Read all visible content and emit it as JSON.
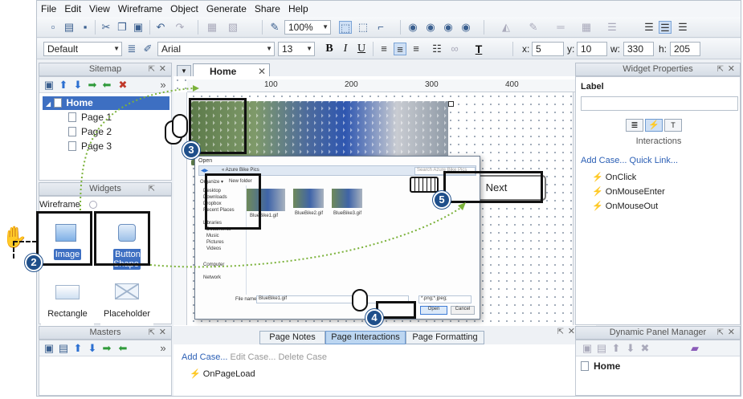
{
  "menu": [
    "File",
    "Edit",
    "View",
    "Wireframe",
    "Object",
    "Generate",
    "Share",
    "Help"
  ],
  "toolbar": {
    "zoom": "100%"
  },
  "format_bar": {
    "style": "Default",
    "font": "Arial",
    "size": "13",
    "x_label": "x:",
    "x": "5",
    "y_label": "y:",
    "y": "10",
    "w_label": "w:",
    "w": "330",
    "h_label": "h:",
    "h": "205"
  },
  "sitemap": {
    "title": "Sitemap",
    "root": "Home",
    "pages": [
      "Page 1",
      "Page 2",
      "Page 3"
    ]
  },
  "widgets": {
    "title": "Widgets",
    "library": "Wireframe",
    "items": [
      "Image",
      "Button Shape",
      "Rectangle",
      "Placeholder"
    ]
  },
  "masters": {
    "title": "Masters"
  },
  "canvas": {
    "tab": "Home",
    "ruler": [
      "100",
      "200",
      "300",
      "400"
    ],
    "button_text": "Next"
  },
  "open_dialog": {
    "title": "Open",
    "path": "« Azure Bike Pics",
    "search_placeholder": "Search Azure Bike Pics",
    "organize": "Organize ▾",
    "new_folder": "New folder",
    "nav": [
      "Desktop",
      "Downloads",
      "Dropbox",
      "Recent Places",
      "Libraries",
      "Documents",
      "Music",
      "Pictures",
      "Videos",
      "Computer",
      "Network"
    ],
    "files": [
      "BlueBike1.gif",
      "BlueBike2.gif",
      "BlueBike3.gif"
    ],
    "filename_label": "File name:",
    "filename": "BlueBike1.gif",
    "filetype": "*.png;*.jpeg;",
    "open": "Open",
    "cancel": "Cancel"
  },
  "page_panel": {
    "tabs": [
      "Page Notes",
      "Page Interactions",
      "Page Formatting"
    ],
    "add_case": "Add Case...",
    "edit_case": "Edit Case...",
    "delete_case": "Delete Case",
    "event": "OnPageLoad"
  },
  "widget_properties": {
    "title": "Widget Properties",
    "label": "Label",
    "interactions": "Interactions",
    "add_case": "Add Case...",
    "quick_link": "Quick Link...",
    "events": [
      "OnClick",
      "OnMouseEnter",
      "OnMouseOut"
    ]
  },
  "dynamic_panel_manager": {
    "title": "Dynamic Panel Manager",
    "item": "Home"
  },
  "steps": [
    "2",
    "3",
    "4",
    "5"
  ],
  "colors": {
    "accent": "#3d6fc2",
    "badge": "#1f4f8a",
    "callout_green": "#9ecf5a",
    "arrow_green": "#7bb23a"
  }
}
